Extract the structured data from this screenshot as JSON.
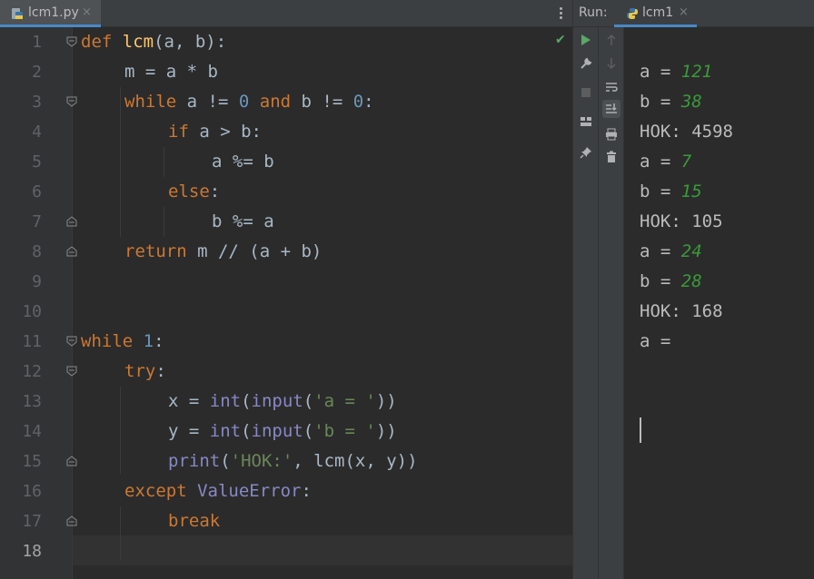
{
  "editor": {
    "tab_label": "lcm1.py",
    "tab_close": "×",
    "line_numbers": [
      "1",
      "2",
      "3",
      "4",
      "5",
      "6",
      "7",
      "8",
      "9",
      "10",
      "11",
      "12",
      "13",
      "14",
      "15",
      "16",
      "17",
      "18"
    ],
    "code": {
      "l1": {
        "kw": "def",
        "sp": " ",
        "fn": "lcm",
        "rest": "(a, b):"
      },
      "l2": {
        "text": "m = a * b"
      },
      "l3": {
        "kw1": "while",
        "t1": " a != ",
        "n1": "0",
        "sp": " ",
        "kw2": "and",
        "t2": " b != ",
        "n2": "0",
        "t3": ":"
      },
      "l4": {
        "kw": "if",
        "rest": " a > b:"
      },
      "l5": {
        "text": "a %= b"
      },
      "l6": {
        "kw": "else",
        "rest": ":"
      },
      "l7": {
        "text": "b %= a"
      },
      "l8": {
        "kw": "return",
        "rest": " m // (a + b)"
      },
      "l11": {
        "kw": "while",
        "sp": " ",
        "num": "1",
        "rest": ":"
      },
      "l12": {
        "kw": "try",
        "rest": ":"
      },
      "l13": {
        "t1": "x = ",
        "bi1": "int",
        "p1": "(",
        "bi2": "input",
        "p2": "(",
        "str": "'a = '",
        "p3": "))"
      },
      "l14": {
        "t1": "y = ",
        "bi1": "int",
        "p1": "(",
        "bi2": "input",
        "p2": "(",
        "str": "'b = '",
        "p3": "))"
      },
      "l15": {
        "bi": "print",
        "p1": "(",
        "str": "'НОК:'",
        "p2": ", lcm(x, y))"
      },
      "l16": {
        "kw": "except",
        "sp": " ",
        "bi": "ValueError",
        "rest": ":"
      },
      "l17": {
        "kw": "break"
      }
    }
  },
  "run": {
    "label": "Run:",
    "tab_label": "lcm1",
    "tab_close": "×",
    "output": [
      {
        "prefix": "a = ",
        "input": "121"
      },
      {
        "prefix": "b = ",
        "input": "38"
      },
      {
        "prefix": "НОК: 4598",
        "input": ""
      },
      {
        "prefix": "a = ",
        "input": "7"
      },
      {
        "prefix": "b = ",
        "input": "15"
      },
      {
        "prefix": "НОК: 105",
        "input": ""
      },
      {
        "prefix": "a = ",
        "input": "24"
      },
      {
        "prefix": "b = ",
        "input": "28"
      },
      {
        "prefix": "НОК: 168",
        "input": ""
      },
      {
        "prefix": "a = ",
        "input": ""
      }
    ]
  },
  "colors": {
    "keyword": "#cc7832",
    "function": "#ffc66d",
    "number": "#6897bb",
    "string": "#6a8759",
    "builtin": "#8888c6",
    "input_text": "#3a9a3a",
    "run_icon": "#59a869",
    "accent_tab": "#4a88c7"
  },
  "icons": [
    "python-file-icon",
    "kebab-menu-icon",
    "check-icon",
    "run-icon",
    "wrench-icon",
    "stop-icon",
    "layout-icon",
    "pin-icon",
    "arrow-up-icon",
    "arrow-down-icon",
    "soft-wrap-icon",
    "scroll-to-end-icon",
    "print-icon",
    "trash-icon"
  ]
}
